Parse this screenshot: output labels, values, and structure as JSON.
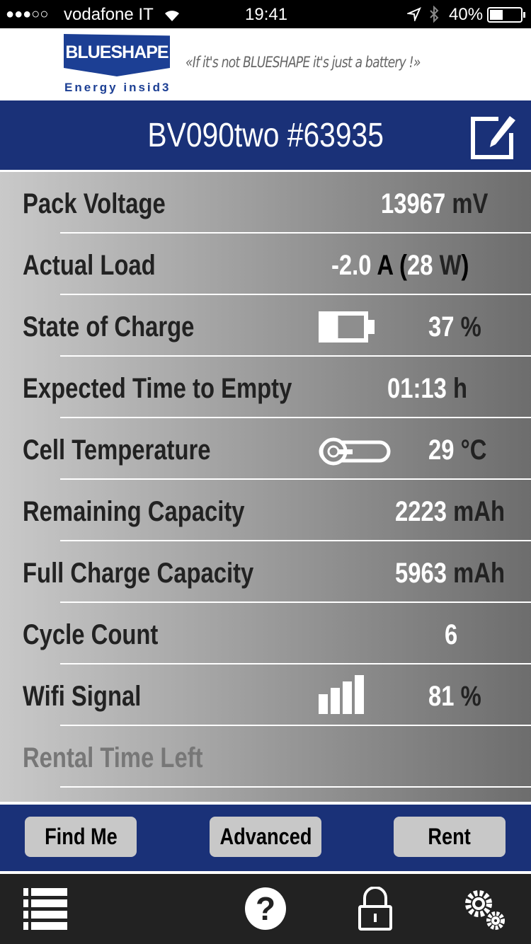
{
  "status_bar": {
    "signal": "●●●○○",
    "carrier": "vodafone IT",
    "time": "19:41",
    "battery": "40%"
  },
  "header": {
    "logo_text": "BLUESHAPE",
    "logo_tagline": "Energy insid3",
    "slogan": "«If it's not BLUESHAPE it's just a battery !»"
  },
  "title": "BV090two #63935",
  "rows": [
    {
      "label": "Pack Voltage",
      "number": "13967",
      "unit": "mV"
    },
    {
      "label": "Actual Load",
      "current": "-2.0",
      "current_unit": "A",
      "open": "(",
      "power": "28",
      "power_unit": "W",
      "close": ")"
    },
    {
      "label": "State of Charge",
      "number": "37",
      "unit": "%",
      "icon": "battery-icon",
      "level_percent": 37
    },
    {
      "label": "Expected Time to Empty",
      "number": "01:13",
      "unit": "h"
    },
    {
      "label": "Cell Temperature",
      "number": "29",
      "unit": "°C",
      "icon": "thermometer-icon"
    },
    {
      "label": "Remaining Capacity",
      "number": "2223",
      "unit": "mAh"
    },
    {
      "label": "Full Charge Capacity",
      "number": "5963",
      "unit": "mAh"
    },
    {
      "label": "Cycle Count",
      "number": "6"
    },
    {
      "label": "Wifi Signal",
      "number": "81",
      "unit": "%",
      "icon": "signal-bars-icon",
      "level_percent": 81
    },
    {
      "label": "Rental Time Left"
    }
  ],
  "actions": {
    "find_me": "Find Me",
    "advanced": "Advanced",
    "rent": "Rent"
  },
  "tabbar": [
    "list-icon",
    "help-icon",
    "lock-icon",
    "settings-icon"
  ],
  "colors": {
    "brand_blue": "#1a3178",
    "tabbar": "#222222"
  }
}
